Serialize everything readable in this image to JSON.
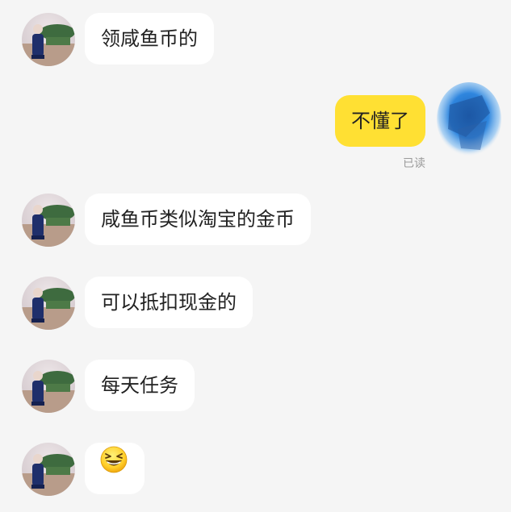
{
  "messages": [
    {
      "side": "left",
      "text": "领咸鱼币的"
    },
    {
      "side": "right",
      "text": "不懂了",
      "status": "已读"
    },
    {
      "side": "left",
      "text": "咸鱼币类似淘宝的金币"
    },
    {
      "side": "left",
      "text": "可以抵扣现金的"
    },
    {
      "side": "left",
      "text": "每天任务"
    },
    {
      "side": "left",
      "emoji": "grinning-squinting-face-emoji"
    }
  ],
  "colors": {
    "background": "#f5f5f5",
    "incoming_bubble": "#ffffff",
    "outgoing_bubble": "#ffe033",
    "read_status": "#9a9a9a"
  }
}
